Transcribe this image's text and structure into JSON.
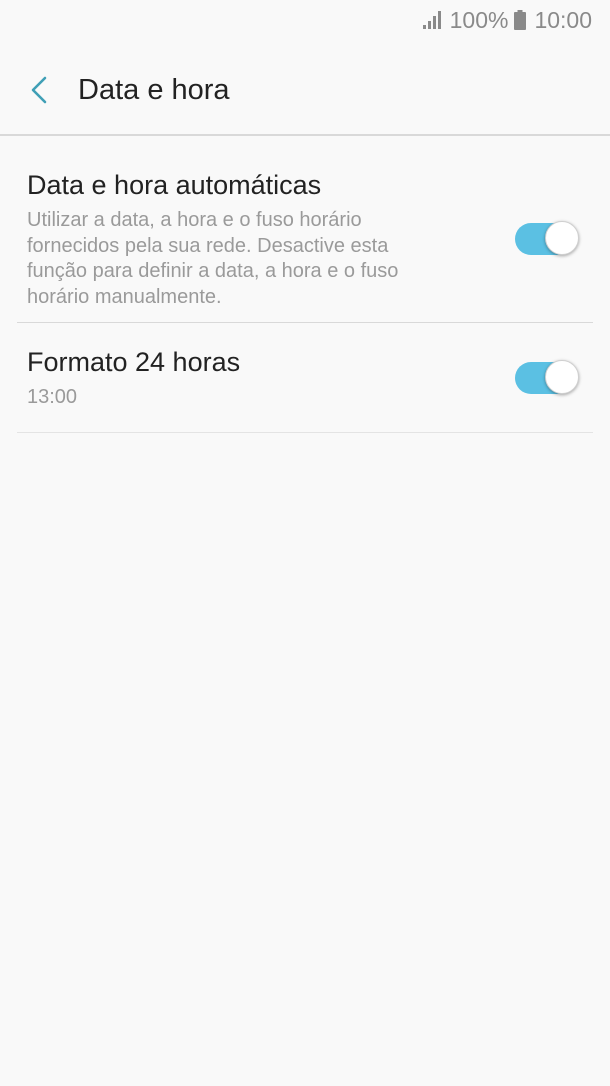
{
  "status_bar": {
    "signal_icon": "signal-icon",
    "battery_percent": "100%",
    "battery_icon": "battery-icon",
    "time": "10:00"
  },
  "header": {
    "back_icon": "chevron-left-icon",
    "title": "Data e hora"
  },
  "colors": {
    "accent": "#3f9fb6",
    "toggle_on": "#5bc0e3"
  },
  "settings": [
    {
      "title": "Data e hora automáticas",
      "description": "Utilizar a data, a hora e o fuso horário fornecidos pela sua rede. Desactive esta função para definir a data, a hora e o fuso horário manualmente.",
      "toggle_on": true
    },
    {
      "title": "Formato 24 horas",
      "description": "13:00",
      "toggle_on": true
    }
  ]
}
